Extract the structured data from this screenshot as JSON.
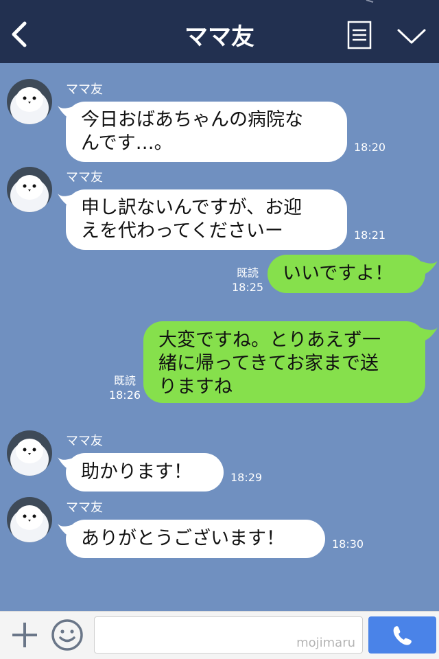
{
  "header": {
    "title": "ママ友",
    "back_icon": "chevron-left-icon",
    "notes_icon": "notes-icon",
    "menu_icon": "chevron-down-icon"
  },
  "colors": {
    "header_bg": "#223050",
    "chat_bg": "#7090c0",
    "incoming_bubble": "#ffffff",
    "outgoing_bubble": "#86e04c",
    "send_button": "#4a83e8"
  },
  "messages": [
    {
      "direction": "in",
      "sender": "ママ友",
      "lines": [
        "今日おばあちゃんの病院な",
        "んです…。"
      ],
      "time": "18:20"
    },
    {
      "direction": "in",
      "sender": "ママ友",
      "lines": [
        "申し訳ないんですが、お迎",
        "えを代わってくださいー"
      ],
      "time": "18:21"
    },
    {
      "direction": "out",
      "lines": [
        "いいですよ！"
      ],
      "read": "既読",
      "time": "18:25"
    },
    {
      "direction": "out",
      "lines": [
        "大変ですね。とりあえず一",
        "緒に帰ってきてお家まで送",
        "りますね"
      ],
      "read": "既読",
      "time": "18:26"
    },
    {
      "direction": "in",
      "sender": "ママ友",
      "lines": [
        "助かります！"
      ],
      "time": "18:29"
    },
    {
      "direction": "in",
      "sender": "ママ友",
      "lines": [
        "ありがとうございます！"
      ],
      "time": "18:30"
    }
  ],
  "footer": {
    "plus_icon": "plus-icon",
    "emoji_icon": "smiley-icon",
    "input_value": "",
    "watermark": "mojimaru",
    "call_icon": "phone-icon"
  }
}
